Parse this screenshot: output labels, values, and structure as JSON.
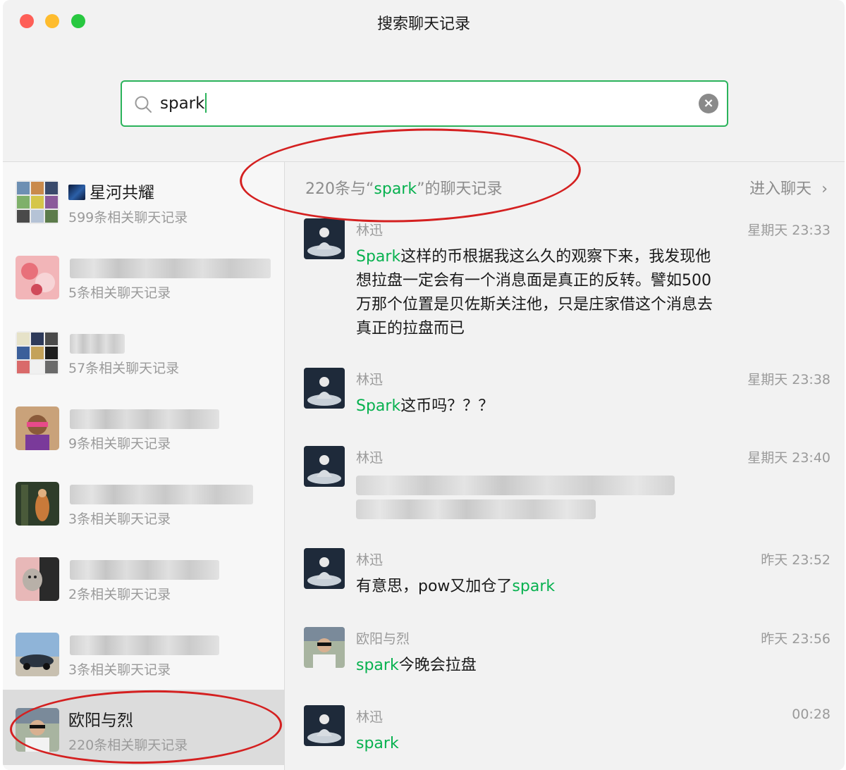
{
  "window": {
    "title": "搜索聊天记录"
  },
  "search": {
    "query": "spark",
    "icon": "search-icon",
    "clear_icon": "clear-icon"
  },
  "left_list": {
    "items": [
      {
        "name": "星河共耀",
        "count": "599条相关聊天记录",
        "name_visible": true
      },
      {
        "name": "",
        "count": "5条相关聊天记录",
        "name_visible": false
      },
      {
        "name": "",
        "count": "57条相关聊天记录",
        "name_visible": false
      },
      {
        "name": "",
        "count": "9条相关聊天记录",
        "name_visible": false
      },
      {
        "name": "",
        "count": "3条相关聊天记录",
        "name_visible": false
      },
      {
        "name": "",
        "count": "2条相关聊天记录",
        "name_visible": false
      },
      {
        "name": "",
        "count": "3条相关聊天记录",
        "name_visible": false
      },
      {
        "name": "欧阳与烈",
        "count": "220条相关聊天记录",
        "name_visible": true,
        "selected": true
      }
    ]
  },
  "results": {
    "header_prefix": "220条与“",
    "header_keyword": "spark",
    "header_suffix": "”的聊天记录",
    "enter_chat": "进入聊天",
    "messages": [
      {
        "sender": "林迅",
        "time": "星期天 23:33",
        "keyword": "Spark",
        "text": "这样的币根据我这么久的观察下来，我发现他想拉盘一定会有一个消息面是真正的反转。譬如500万那个位置是贝佐斯关注他，只是庄家借这个消息去真正的拉盘而已"
      },
      {
        "sender": "林迅",
        "time": "星期天 23:38",
        "keyword": "Spark",
        "text": "这币吗？？？"
      },
      {
        "sender": "林迅",
        "time": "星期天 23:40",
        "keyword": "",
        "text": ""
      },
      {
        "sender": "林迅",
        "time": "昨天 23:52",
        "keyword": "spark",
        "text": "有意思，pow又加仓了"
      },
      {
        "sender": "欧阳与烈",
        "time": "昨天 23:56",
        "keyword": "spark",
        "text": "今晚会拉盘"
      },
      {
        "sender": "林迅",
        "time": "00:28",
        "keyword": "spark",
        "text": ""
      }
    ]
  },
  "colors": {
    "accent": "#07b14f",
    "search_border": "#2bb35b",
    "annotation": "#d42020"
  }
}
